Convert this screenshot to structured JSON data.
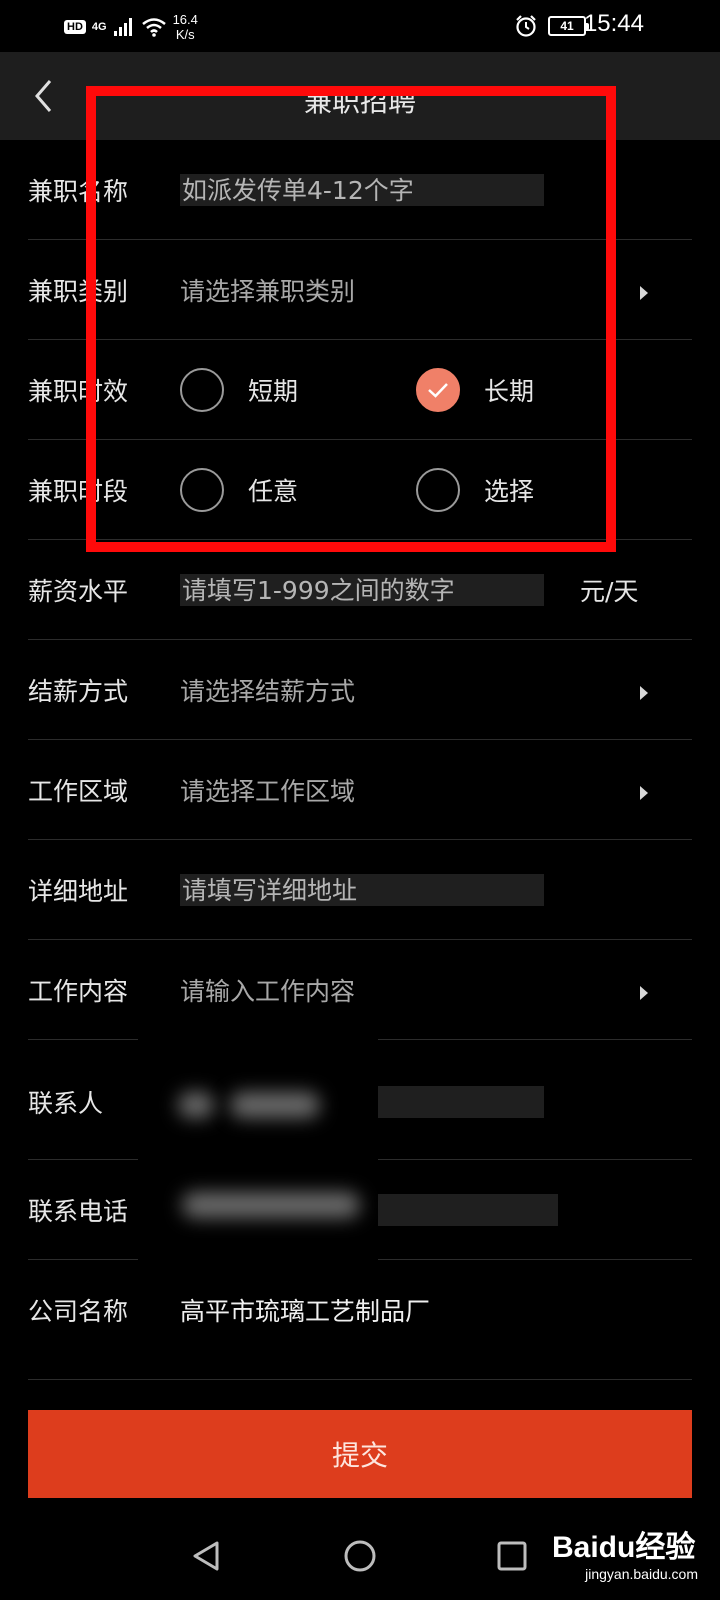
{
  "status_bar": {
    "hd_badge": "HD",
    "network": "4G",
    "speed_value": "16.4",
    "speed_unit": "K/s",
    "battery": "41",
    "time": "15:44"
  },
  "header": {
    "title": "兼职招聘"
  },
  "form": {
    "job_name": {
      "label": "兼职名称",
      "placeholder": "如派发传单4-12个字"
    },
    "job_category": {
      "label": "兼职类别",
      "placeholder": "请选择兼职类别"
    },
    "job_duration": {
      "label": "兼职时效",
      "options": [
        "短期",
        "长期"
      ],
      "selected": "长期"
    },
    "job_period": {
      "label": "兼职时段",
      "options": [
        "任意",
        "选择"
      ],
      "selected": ""
    },
    "salary": {
      "label": "薪资水平",
      "placeholder": "请填写1-999之间的数字",
      "unit": "元/天"
    },
    "payment_method": {
      "label": "结薪方式",
      "placeholder": "请选择结薪方式"
    },
    "work_area": {
      "label": "工作区域",
      "placeholder": "请选择工作区域"
    },
    "address": {
      "label": "详细地址",
      "placeholder": "请填写详细地址"
    },
    "work_content": {
      "label": "工作内容",
      "placeholder": "请输入工作内容"
    },
    "contact_person": {
      "label": "联系人"
    },
    "contact_phone": {
      "label": "联系电话"
    },
    "company_name": {
      "label": "公司名称",
      "value": "高平市琉璃工艺制品厂"
    }
  },
  "submit_label": "提交",
  "colors": {
    "accent": "#dd3d1d",
    "radio_checked": "#f08068",
    "highlight_box": "#ff0a0a",
    "background": "#000000",
    "title_bar": "#1e1e1e"
  },
  "icons": {
    "back": "chevron-left-icon",
    "checked": "check-icon",
    "nav_back": "triangle-back-icon",
    "nav_home": "circle-home-icon",
    "nav_recent": "square-recent-icon"
  },
  "watermark": {
    "main": "Baidu经验",
    "sub": "jingyan.baidu.com"
  }
}
